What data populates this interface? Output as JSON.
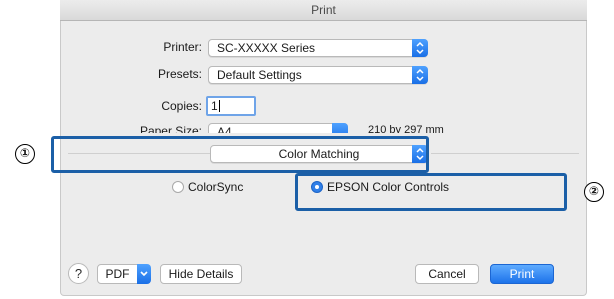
{
  "window": {
    "title": "Print"
  },
  "printer": {
    "label": "Printer:",
    "value": "SC-XXXXX Series"
  },
  "presets": {
    "label": "Presets:",
    "value": "Default Settings"
  },
  "copies": {
    "label": "Copies:",
    "value": "1"
  },
  "paper": {
    "label": "Paper Size:",
    "value": "A4",
    "dimensions": "210 by 297 mm"
  },
  "panel": {
    "value": "Color Matching"
  },
  "radios": [
    {
      "label": "ColorSync",
      "selected": false
    },
    {
      "label": "EPSON Color Controls",
      "selected": true
    }
  ],
  "callouts": {
    "one": "①",
    "two": "②"
  },
  "footer": {
    "help": "?",
    "pdf": "PDF",
    "hide_details": "Hide Details",
    "cancel": "Cancel",
    "print": "Print"
  },
  "colors": {
    "accent": "#1d73ea",
    "callout": "#1b5fa7"
  }
}
